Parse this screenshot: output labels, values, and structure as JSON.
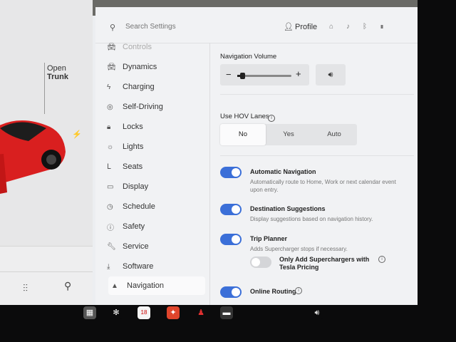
{
  "left_panel": {
    "trunk_line1": "Open",
    "trunk_line2": "Trunk",
    "charge_icon": "lightning-icon",
    "car_color": "#d91f1f"
  },
  "header": {
    "search_placeholder": "Search Settings",
    "profile_label": "Profile",
    "icons": [
      "home-icon",
      "bell-icon",
      "bluetooth-icon",
      "signal-icon"
    ]
  },
  "sidebar": {
    "items": [
      {
        "label": "Controls",
        "icon": "car-icon"
      },
      {
        "label": "Dynamics",
        "icon": "car-icon"
      },
      {
        "label": "Charging",
        "icon": "lightning-icon"
      },
      {
        "label": "Self-Driving",
        "icon": "steering-wheel-icon"
      },
      {
        "label": "Locks",
        "icon": "lock-icon"
      },
      {
        "label": "Lights",
        "icon": "sun-icon"
      },
      {
        "label": "Seats",
        "icon": "seat-icon"
      },
      {
        "label": "Display",
        "icon": "display-icon"
      },
      {
        "label": "Schedule",
        "icon": "clock-icon"
      },
      {
        "label": "Safety",
        "icon": "info-icon"
      },
      {
        "label": "Service",
        "icon": "wrench-icon"
      },
      {
        "label": "Software",
        "icon": "download-icon"
      },
      {
        "label": "Navigation",
        "icon": "navigation-arrow-icon"
      }
    ],
    "active": "Navigation"
  },
  "navigation": {
    "volume_title": "Navigation Volume",
    "volume_level": 0.05,
    "hov_title": "Use HOV Lanes",
    "hov_options": [
      "No",
      "Yes",
      "Auto"
    ],
    "hov_selected": "No",
    "options": [
      {
        "title": "Automatic Navigation",
        "desc": "Automatically route to Home, Work or next calendar event upon entry.",
        "on": true
      },
      {
        "title": "Destination Suggestions",
        "desc": "Display suggestions based on navigation history.",
        "on": true
      },
      {
        "title": "Trip Planner",
        "desc": "Adds Supercharger stops if necessary.",
        "on": true
      },
      {
        "title": "Only Add Superchargers with Tesla Pricing",
        "desc": "",
        "on": false
      },
      {
        "title": "Online Routing",
        "desc": "",
        "on": true
      }
    ]
  },
  "taskbar": {
    "calendar_day": "18",
    "icons": [
      "apps-icon",
      "fan-icon",
      "calendar-icon",
      "game-icon",
      "joystick-icon",
      "card-icon",
      "volume-icon"
    ]
  }
}
